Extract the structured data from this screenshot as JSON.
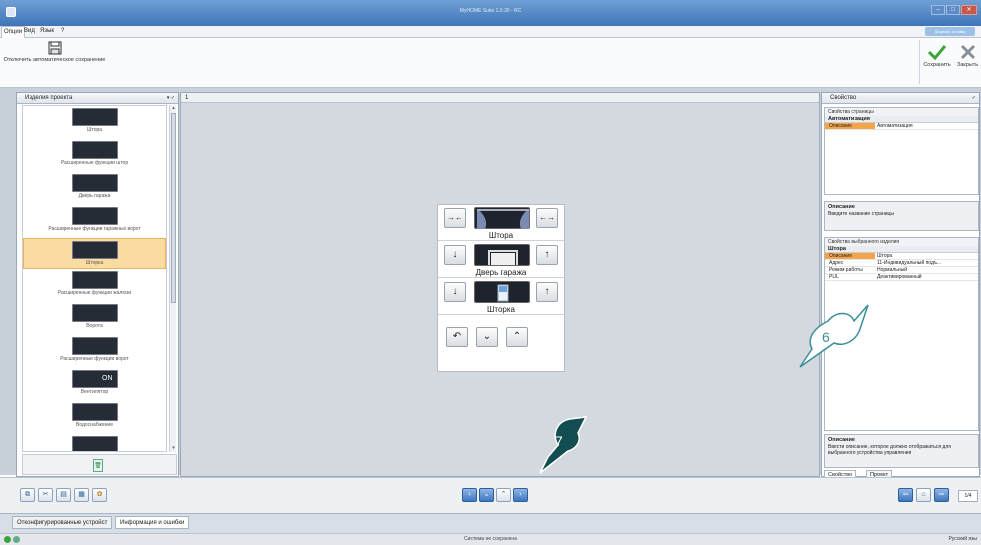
{
  "window": {
    "title": "MyHOME Suite 1.0.30 - RC",
    "user_badge": "Ширмыч Ылайщ"
  },
  "menu": {
    "items": [
      "Опции",
      "Вид",
      "Язык",
      "?"
    ]
  },
  "ribbon": {
    "autosave_label": "Отключить автоматическое сохранение",
    "save_label": "Сохранить",
    "close_label": "Закрыть"
  },
  "left_panel": {
    "title": "Изделия проекта",
    "items": [
      {
        "label": "Штора",
        "icon": "curtain-icon"
      },
      {
        "label": "Расширенные функции штор",
        "icon": "curtain-advanced-icon"
      },
      {
        "label": "Дверь гаража",
        "icon": "garage-door-icon"
      },
      {
        "label": "Расширенные функции гаражных ворот",
        "icon": "garage-advanced-icon"
      },
      {
        "label": "Шторка",
        "icon": "blind-icon",
        "selected": true
      },
      {
        "label": "Расширенные функции жалюзи",
        "icon": "blind-advanced-icon"
      },
      {
        "label": "Ворота",
        "icon": "gate-icon"
      },
      {
        "label": "Расширенные функции ворот",
        "icon": "gate-advanced-icon"
      },
      {
        "label": "Вентилятор",
        "icon": "fan-icon",
        "badge": "ON"
      },
      {
        "label": "Водоснабжение",
        "icon": "faucet-icon"
      },
      {
        "label": "",
        "icon": "valve-icon"
      }
    ]
  },
  "canvas": {
    "page_number": "1",
    "rows": [
      {
        "label": "Штора",
        "left": "→←",
        "right": "←→"
      },
      {
        "label": "Дверь гаража",
        "left": "↓",
        "right": "↑"
      },
      {
        "label": "Шторка",
        "left": "↓",
        "right": "↑"
      }
    ],
    "nav": [
      "↶",
      "⌄",
      "⌃"
    ]
  },
  "right_panel": {
    "title": "Свойство",
    "page_props_title": "Свойства страницы",
    "page_group": "Автоматизация",
    "page_rows": [
      {
        "key": "Описание",
        "value": "Автоматизация"
      }
    ],
    "page_desc_title": "Описание",
    "page_desc_text": "Введите название страницы",
    "device_props_title": "Свойства выбранного изделия",
    "device_group": "Штора",
    "device_rows": [
      {
        "key": "Описание",
        "value": "Штора"
      },
      {
        "key": "Адрес",
        "value": "11-Индивидуальный подъ..."
      },
      {
        "key": "Режим работы",
        "value": "Нормальный"
      },
      {
        "key": "PUL",
        "value": "Деактивированный"
      }
    ],
    "device_desc_title": "Описание",
    "device_desc_text": "Ввести описание, которое должно отображаться для выбранного устройства управления",
    "tabs": [
      "Свойство",
      "Проект"
    ]
  },
  "toolbar_bottom": {
    "page_counter": "1/4"
  },
  "log_tabs": [
    "Отконфигурированные устройст",
    "Информация и ошибки"
  ],
  "status": {
    "text": "Система не сохранена",
    "language": "Русский язы"
  },
  "callouts": [
    "6",
    "7"
  ]
}
